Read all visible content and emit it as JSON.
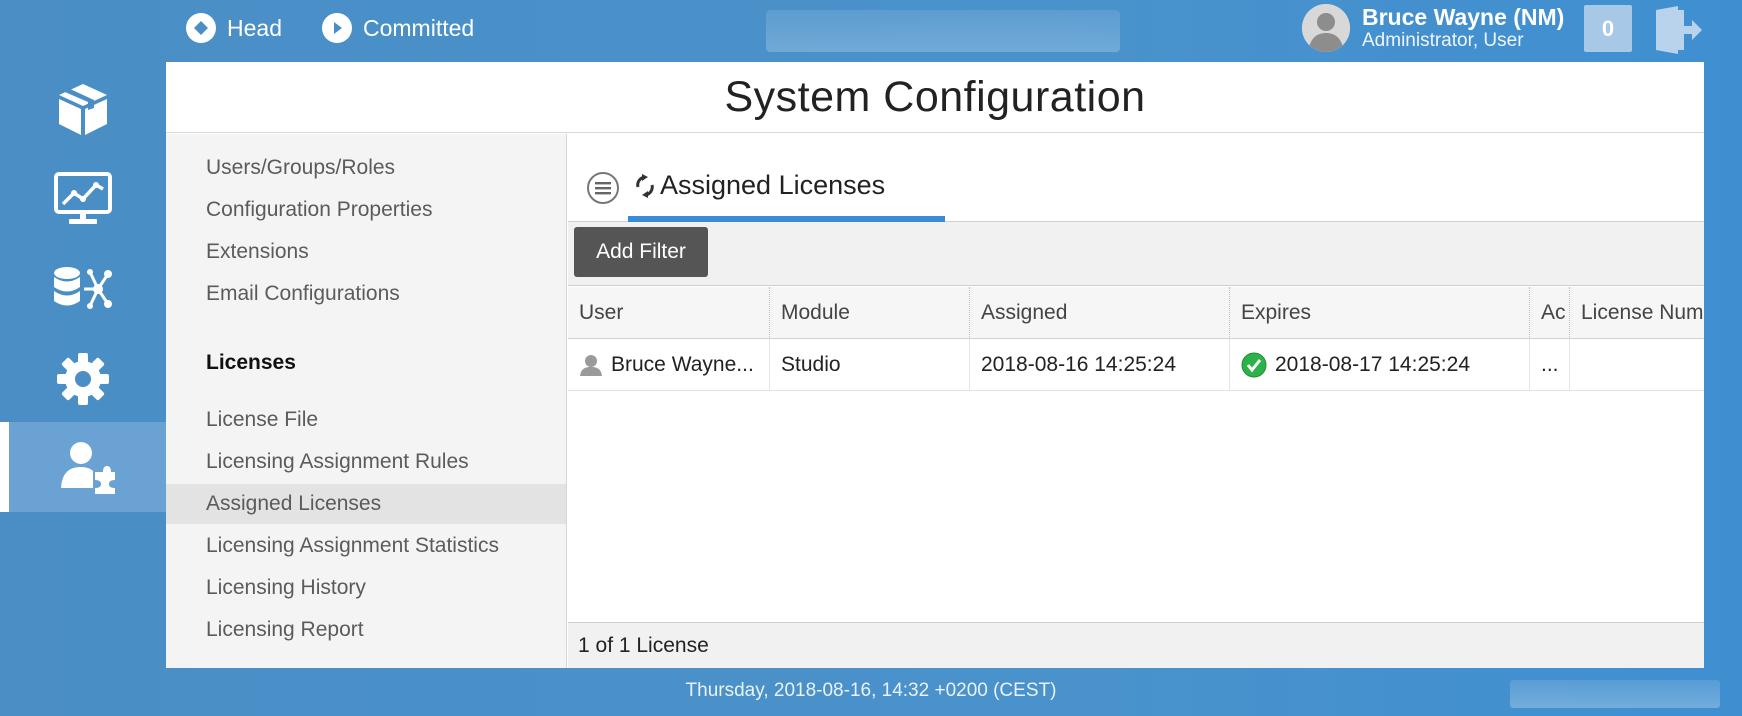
{
  "header": {
    "branches": [
      {
        "label": "Head",
        "icon": "diamond-icon"
      },
      {
        "label": "Committed",
        "icon": "play-icon"
      }
    ],
    "user": {
      "name": "Bruce Wayne (NM)",
      "role": "Administrator, User"
    },
    "notification_count": "0"
  },
  "leftnav": {
    "items": [
      {
        "icon": "package-icon"
      },
      {
        "icon": "monitor-chart-icon"
      },
      {
        "icon": "database-network-icon"
      },
      {
        "icon": "gear-icon"
      },
      {
        "icon": "user-puzzle-icon",
        "active": true
      }
    ]
  },
  "page": {
    "title": "System Configuration"
  },
  "sidemenu": {
    "group1": [
      "Users/Groups/Roles",
      "Configuration Properties",
      "Extensions",
      "Email Configurations"
    ],
    "heading": "Licenses",
    "group2": [
      "License File",
      "Licensing Assignment Rules",
      "Assigned Licenses",
      "Licensing Assignment Statistics",
      "Licensing History",
      "Licensing Report"
    ],
    "selected": "Assigned Licenses"
  },
  "main": {
    "tab_label": "Assigned Licenses",
    "add_filter_label": "Add Filter",
    "columns": [
      "User",
      "Module",
      "Assigned",
      "Expires",
      "Ac",
      "License Num"
    ],
    "rows": [
      {
        "user": "Bruce Wayne...",
        "module": "Studio",
        "assigned": "2018-08-16 14:25:24",
        "expires": "2018-08-17 14:25:24",
        "ac": "...",
        "license_num": ""
      }
    ],
    "count_text": "1 of 1 License"
  },
  "status": {
    "datetime": "Thursday, 2018-08-16, 14:32 +0200 (CEST)"
  },
  "colors": {
    "background": "#4a8ec5",
    "tab_underline": "#3b8ad8",
    "valid_green": "#2db24a"
  }
}
